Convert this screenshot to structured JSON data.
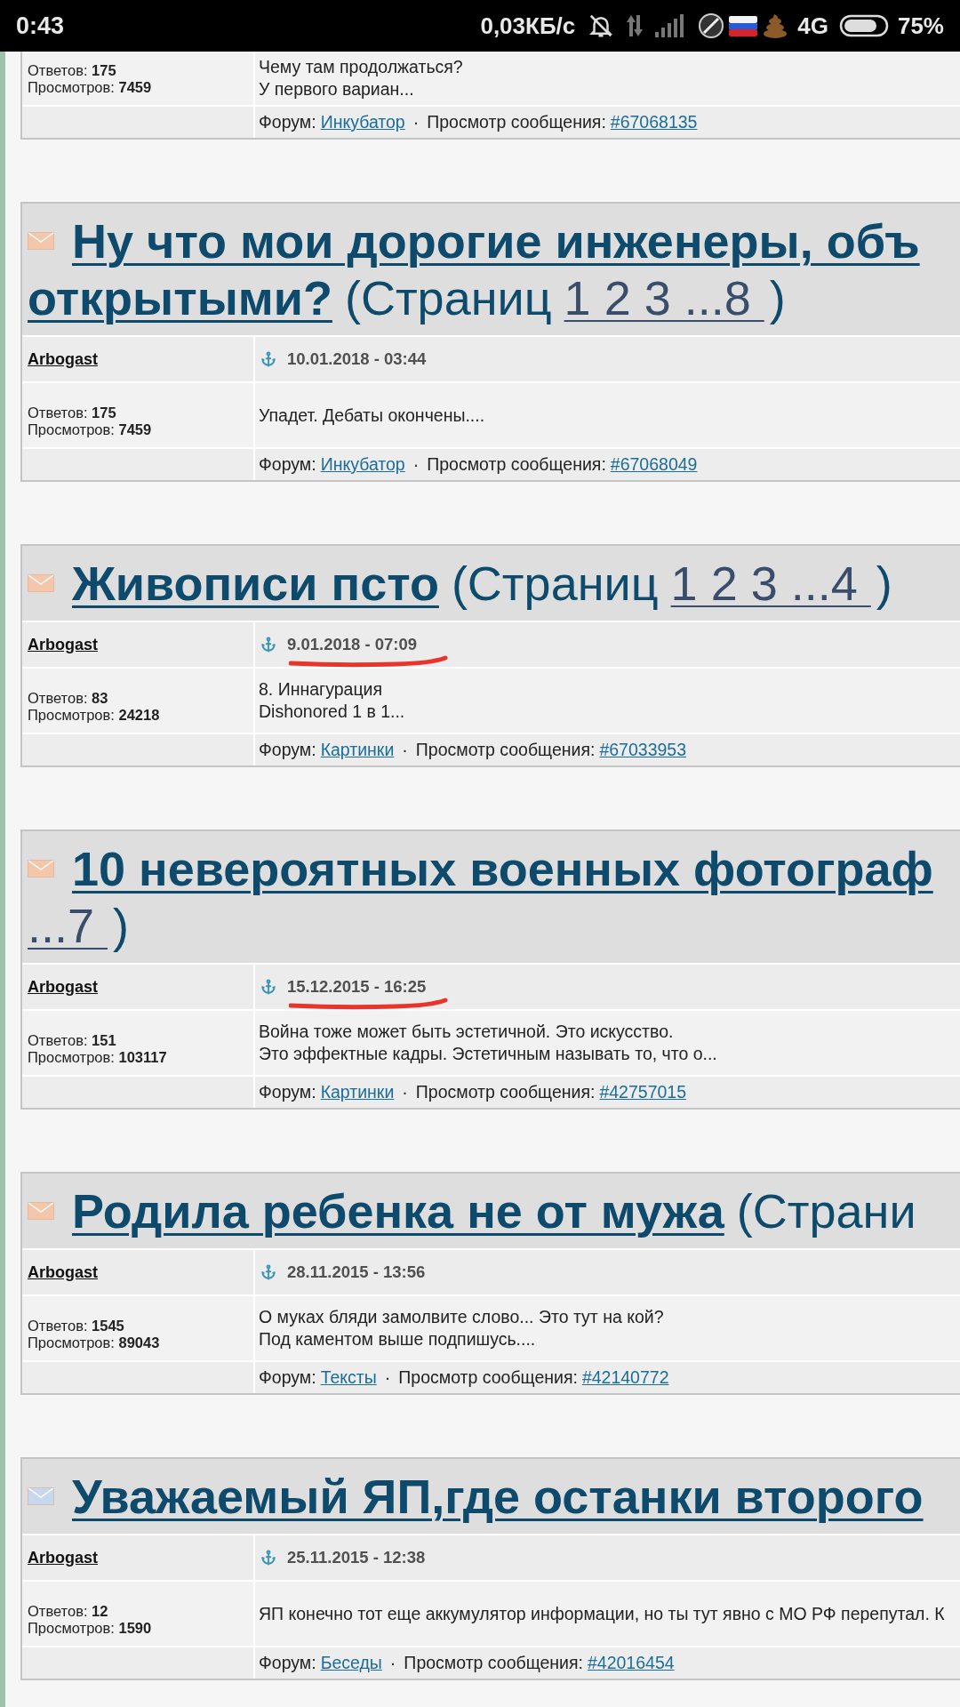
{
  "status_bar": {
    "time": "0:43",
    "network_speed": "0,03КБ/с",
    "network_type": "4G",
    "battery": "75%"
  },
  "topics": [
    {
      "kind": "partial",
      "replies_label": "Ответов:",
      "replies": "175",
      "views_label": "Просмотров:",
      "views": "7459",
      "excerpt_lines": [
        "Чему там продолжаться?",
        "У первого вариан..."
      ],
      "forum_label": "Форум:",
      "forum": "Инкубатор",
      "separator": "·",
      "post_label": "Просмотр сообщения:",
      "post": "#67068135"
    },
    {
      "kind": "full",
      "color": "#f4c6aa",
      "heading": [
        [
          {
            "kind": "title",
            "text": "Ну что мои дорогие инженеры, объ"
          }
        ],
        [
          {
            "kind": "title",
            "text": "открытыми?"
          },
          {
            "kind": "plain",
            "text": "(Страниц"
          },
          {
            "kind": "pages",
            "text": "1 2 3 ...8"
          },
          {
            "kind": "plain",
            "text": ")"
          }
        ]
      ],
      "author": "Arbogast",
      "date": "10.01.2018 - 03:44",
      "marked": false,
      "replies_label": "Ответов:",
      "replies": "175",
      "views_label": "Просмотров:",
      "views": "7459",
      "excerpt_lines": [
        "Упадет. Дебаты окончены...."
      ],
      "forum_label": "Форум:",
      "forum": "Инкубатор",
      "separator": "·",
      "post_label": "Просмотр сообщения:",
      "post": "#67068049"
    },
    {
      "kind": "full",
      "color": "#f4c6aa",
      "heading": [
        [
          {
            "kind": "title",
            "text": "Живописи псто"
          },
          {
            "kind": "plain",
            "text": "(Страниц"
          },
          {
            "kind": "pages",
            "text": "1 2 3 ...4"
          },
          {
            "kind": "plain",
            "text": ")"
          }
        ]
      ],
      "author": "Arbogast",
      "date": "9.01.2018 - 07:09",
      "marked": true,
      "replies_label": "Ответов:",
      "replies": "83",
      "views_label": "Просмотров:",
      "views": "24218",
      "excerpt_lines": [
        "8. Иннагурация",
        "Dishonored 1 в 1..."
      ],
      "forum_label": "Форум:",
      "forum": "Картинки",
      "separator": "·",
      "post_label": "Просмотр сообщения:",
      "post": "#67033953"
    },
    {
      "kind": "full",
      "color": "#f4c6aa",
      "heading": [
        [
          {
            "kind": "title",
            "text": "10 невероятных военных фотограф"
          }
        ],
        [
          {
            "kind": "pages",
            "text": "...7"
          },
          {
            "kind": "plain",
            "text": ")"
          }
        ]
      ],
      "author": "Arbogast",
      "date": "15.12.2015 - 16:25",
      "marked": true,
      "replies_label": "Ответов:",
      "replies": "151",
      "views_label": "Просмотров:",
      "views": "103117",
      "excerpt_lines": [
        "Война тоже может быть эстетичной. Это искусство.",
        "Это эффектные кадры. Эстетичным называть то, что о..."
      ],
      "forum_label": "Форум:",
      "forum": "Картинки",
      "separator": "·",
      "post_label": "Просмотр сообщения:",
      "post": "#42757015"
    },
    {
      "kind": "full",
      "color": "#f4c6aa",
      "heading": [
        [
          {
            "kind": "title",
            "text": "Родила ребенка не от мужа"
          },
          {
            "kind": "plain",
            "text": "(Страни"
          }
        ]
      ],
      "author": "Arbogast",
      "date": "28.11.2015 - 13:56",
      "marked": false,
      "replies_label": "Ответов:",
      "replies": "1545",
      "views_label": "Просмотров:",
      "views": "89043",
      "excerpt_lines": [
        "О муках бляди замолвите слово... Это тут на кой?",
        "Под каментом выше подпишусь...."
      ],
      "forum_label": "Форум:",
      "forum": "Тексты",
      "separator": "·",
      "post_label": "Просмотр сообщения:",
      "post": "#42140772"
    },
    {
      "kind": "full",
      "color": "#c6d7ee",
      "heading": [
        [
          {
            "kind": "title",
            "text": "Уважаемый ЯП,где останки второго"
          }
        ]
      ],
      "author": "Arbogast",
      "date": "25.11.2015 - 12:38",
      "marked": false,
      "replies_label": "Ответов:",
      "replies": "12",
      "views_label": "Просмотров:",
      "views": "1590",
      "excerpt_lines": [
        "ЯП конечно тот еще аккумулятор информации, но ты тут явно с МО РФ перепутал. К"
      ],
      "forum_label": "Форум:",
      "forum": "Беседы",
      "separator": "·",
      "post_label": "Просмотр сообщения:",
      "post": "#42016454"
    }
  ]
}
